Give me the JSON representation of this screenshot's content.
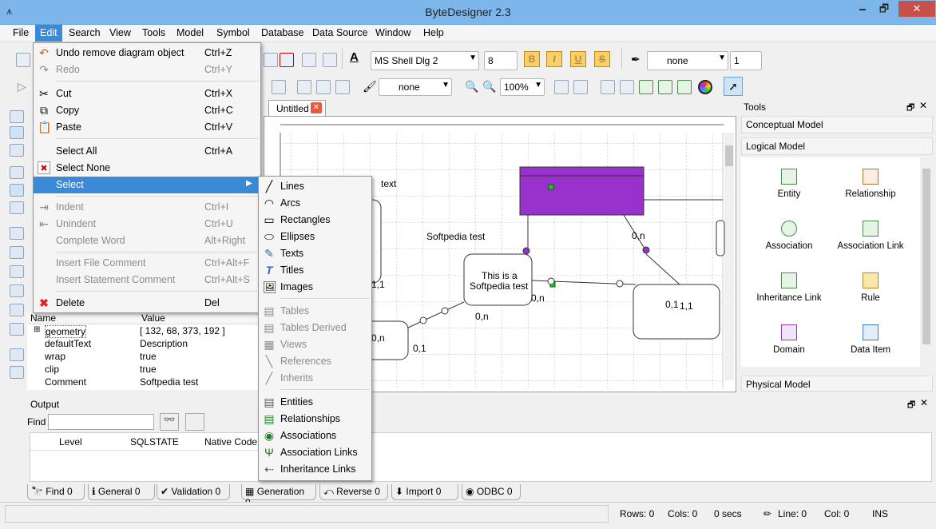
{
  "window": {
    "title": "ByteDesigner 2.3"
  },
  "menubar": [
    "File",
    "Edit",
    "Search",
    "View",
    "Tools",
    "Model",
    "Symbol",
    "Database",
    "Data Source",
    "Window",
    "Help"
  ],
  "toolbar": {
    "font_name": "MS Shell Dlg 2",
    "font_size": "8",
    "line_style": "none",
    "line_width": "1",
    "fill_style": "none",
    "zoom": "100%"
  },
  "edit_menu": [
    {
      "label": "Undo remove diagram object",
      "shortcut": "Ctrl+Z",
      "icon": "undo-icon",
      "disabled": false
    },
    {
      "label": "Redo",
      "shortcut": "Ctrl+Y",
      "icon": "redo-icon",
      "disabled": true
    },
    {
      "label": "Cut",
      "shortcut": "Ctrl+X",
      "icon": "scissors-icon",
      "disabled": false
    },
    {
      "label": "Copy",
      "shortcut": "Ctrl+C",
      "icon": "copy-icon",
      "disabled": false
    },
    {
      "label": "Paste",
      "shortcut": "Ctrl+V",
      "icon": "paste-icon",
      "disabled": false
    },
    {
      "label": "Select All",
      "shortcut": "Ctrl+A",
      "icon": "",
      "disabled": false
    },
    {
      "label": "Select None",
      "shortcut": "",
      "icon": "select-none-icon",
      "disabled": false
    },
    {
      "label": "Select",
      "shortcut": "",
      "icon": "",
      "disabled": false
    },
    {
      "label": "Indent",
      "shortcut": "Ctrl+I",
      "icon": "indent-icon",
      "disabled": true
    },
    {
      "label": "Unindent",
      "shortcut": "Ctrl+U",
      "icon": "unindent-icon",
      "disabled": true
    },
    {
      "label": "Complete Word",
      "shortcut": "Alt+Right",
      "icon": "",
      "disabled": true
    },
    {
      "label": "Insert File Comment",
      "shortcut": "Ctrl+Alt+F",
      "icon": "",
      "disabled": true
    },
    {
      "label": "Insert Statement Comment",
      "shortcut": "Ctrl+Alt+S",
      "icon": "",
      "disabled": true
    },
    {
      "label": "Delete",
      "shortcut": "Del",
      "icon": "delete-icon",
      "disabled": false
    }
  ],
  "select_submenu": [
    {
      "label": "Lines",
      "icon": "line-icon",
      "disabled": false
    },
    {
      "label": "Arcs",
      "icon": "arc-icon",
      "disabled": false
    },
    {
      "label": "Rectangles",
      "icon": "rectangle-icon",
      "disabled": false
    },
    {
      "label": "Ellipses",
      "icon": "ellipse-icon",
      "disabled": false
    },
    {
      "label": "Texts",
      "icon": "text-icon",
      "disabled": false
    },
    {
      "label": "Titles",
      "icon": "title-icon",
      "disabled": false
    },
    {
      "label": "Images",
      "icon": "image-icon",
      "disabled": false
    },
    {
      "label": "Tables",
      "icon": "table-icon",
      "disabled": true
    },
    {
      "label": "Tables Derived",
      "icon": "table-derived-icon",
      "disabled": true
    },
    {
      "label": "Views",
      "icon": "view-icon",
      "disabled": true
    },
    {
      "label": "References",
      "icon": "reference-icon",
      "disabled": true
    },
    {
      "label": "Inherits",
      "icon": "inherit-icon",
      "disabled": true
    },
    {
      "label": "Entities",
      "icon": "entity-icon",
      "disabled": false
    },
    {
      "label": "Relationships",
      "icon": "relationship-icon",
      "disabled": false
    },
    {
      "label": "Associations",
      "icon": "association-icon",
      "disabled": false
    },
    {
      "label": "Association Links",
      "icon": "association-link-icon",
      "disabled": false
    },
    {
      "label": "Inheritance Links",
      "icon": "inheritance-link-icon",
      "disabled": false
    }
  ],
  "document_tab": "Untitled",
  "diagram": {
    "labels": [
      "text",
      "Softpedia test",
      "This is a",
      "Softpedia test",
      "0,n",
      "0,n",
      "0,1",
      "0,1",
      "1,1",
      "0,n",
      "0,n",
      "0,1",
      "1,1",
      "1,1"
    ]
  },
  "tools_panel": {
    "title": "Tools",
    "sections": [
      "Conceptual Model",
      "Logical Model",
      "Physical Model"
    ],
    "items": [
      "Entity",
      "Relationship",
      "Association",
      "Association Link",
      "Inheritance Link",
      "Rule",
      "Domain",
      "Data Item"
    ]
  },
  "properties": {
    "headers": [
      "Name",
      "Value"
    ],
    "rows": [
      {
        "name": "geometry",
        "value": "[ 132, 68, 373, 192 ]"
      },
      {
        "name": "defaultText",
        "value": "Description"
      },
      {
        "name": "wrap",
        "value": "true"
      },
      {
        "name": "clip",
        "value": "true"
      },
      {
        "name": "Comment",
        "value": "Softpedia test"
      }
    ]
  },
  "output": {
    "title": "Output",
    "find_label": "Find",
    "columns": [
      "Level",
      "SQLSTATE",
      "Native Code"
    ]
  },
  "bottom_tabs": [
    "Find 0",
    "General 0",
    "Validation 0",
    "Generation 0",
    "Reverse 0",
    "Import 0",
    "ODBC 0"
  ],
  "status": {
    "rows": "Rows: 0",
    "cols": "Cols: 0",
    "secs": "0 secs",
    "line": "Line: 0",
    "col": "Col: 0",
    "mode": "INS"
  },
  "colors": {
    "accent": "#3a8ad8",
    "entity_fill": "#9932cc",
    "titlebar": "#7db6ea"
  }
}
